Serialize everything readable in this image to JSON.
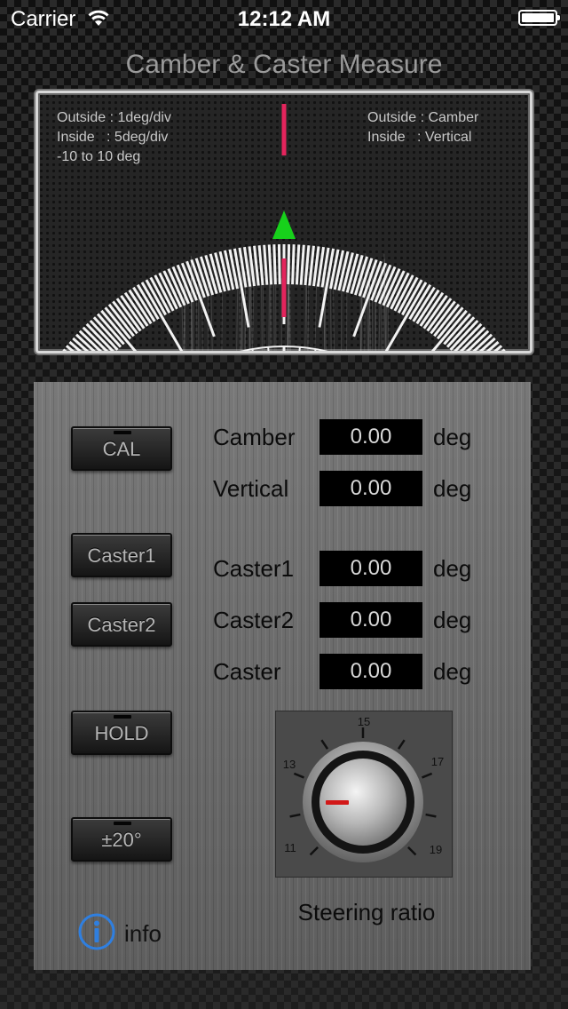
{
  "status_bar": {
    "carrier": "Carrier",
    "time": "12:12 AM"
  },
  "app": {
    "title": "Camber & Caster Measure"
  },
  "gauge": {
    "scale_info_left": "Outside : 1deg/div\nInside   : 5deg/div\n-10 to 10 deg",
    "scale_info_right": "Outside : Camber\nInside   : Vertical",
    "needle_color": "#e4245c",
    "pointer_color": "#17d11b"
  },
  "buttons": {
    "cal": "CAL",
    "caster1": "Caster1",
    "caster2": "Caster2",
    "hold": "HOLD",
    "range": "±20°"
  },
  "measurements": [
    {
      "label": "Camber",
      "value": "0.00",
      "unit": "deg"
    },
    {
      "label": "Vertical",
      "value": "0.00",
      "unit": "deg"
    },
    {
      "label": "Caster1",
      "value": "0.00",
      "unit": "deg"
    },
    {
      "label": "Caster2",
      "value": "0.00",
      "unit": "deg"
    },
    {
      "label": "Caster",
      "value": "0.00",
      "unit": "deg"
    }
  ],
  "steering": {
    "caption": "Steering ratio",
    "dial_labels": [
      "15",
      "13",
      "17",
      "11",
      "19"
    ],
    "indicator_color": "#d21818"
  },
  "info": {
    "label": "info",
    "icon": "info-icon",
    "color": "#2f7fe0"
  }
}
